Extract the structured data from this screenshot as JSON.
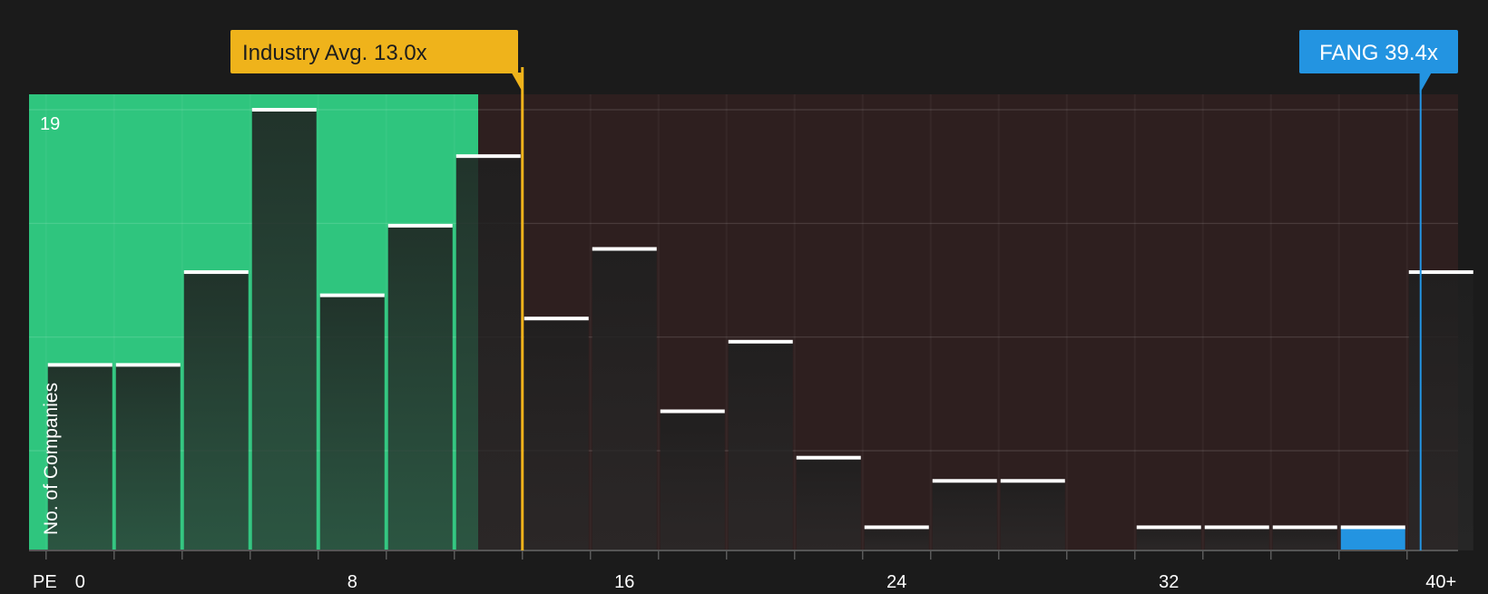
{
  "chart_data": {
    "type": "bar",
    "title": "",
    "xlabel": "PE",
    "ylabel": "No. of Companies",
    "x_ticks": [
      "0",
      "8",
      "16",
      "24",
      "32",
      "40+"
    ],
    "x_tick_values": [
      0,
      8,
      16,
      24,
      32,
      40
    ],
    "y_max_label": "19",
    "ylim": [
      0,
      19
    ],
    "xlim": [
      -1.5,
      40.5
    ],
    "bin_width": 2,
    "bins_start": [
      0,
      2,
      4,
      6,
      8,
      10,
      12,
      14,
      16,
      18,
      20,
      22,
      24,
      26,
      28,
      30,
      32,
      34,
      36,
      38,
      40
    ],
    "values": [
      8,
      8,
      12,
      19,
      11,
      14,
      17,
      10,
      13,
      6,
      9,
      4,
      1,
      3,
      3,
      0,
      1,
      1,
      1,
      1,
      12
    ],
    "highlight_bin_start": 38,
    "industry_avg": {
      "label": "Industry Avg. 13.0x",
      "value": 13.0
    },
    "company": {
      "label": "FANG 39.4x",
      "value": 39.4
    },
    "colors": {
      "background": "#1b1b1b",
      "undervalued_region": "#2fc57e",
      "overvalued_region": "#2e1f1f",
      "bar_fill": "#252525",
      "bar_top": "#ffffff",
      "industry_marker": "#efb31b",
      "company_marker": "#2394e1"
    }
  }
}
